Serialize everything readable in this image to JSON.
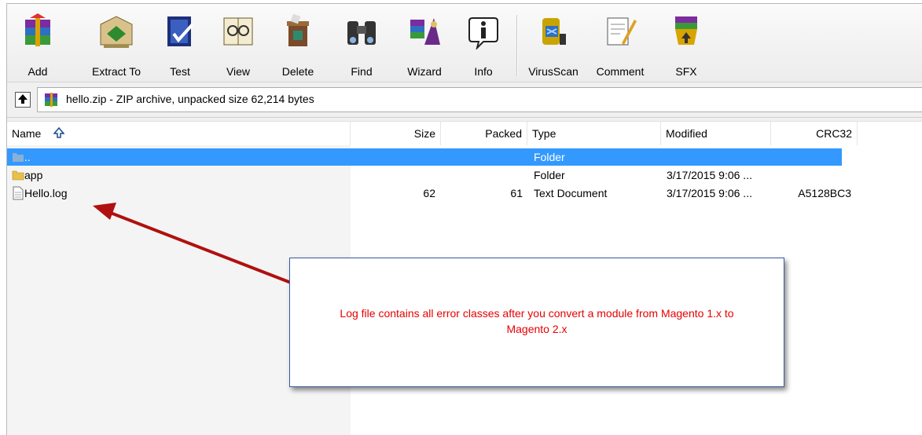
{
  "toolbar": {
    "buttons": [
      {
        "label": "Add",
        "icon": "add-archive-icon"
      },
      {
        "label": "Extract To",
        "icon": "extract-icon"
      },
      {
        "label": "Test",
        "icon": "test-icon"
      },
      {
        "label": "View",
        "icon": "view-icon"
      },
      {
        "label": "Delete",
        "icon": "delete-icon"
      },
      {
        "label": "Find",
        "icon": "find-icon"
      },
      {
        "label": "Wizard",
        "icon": "wizard-icon"
      },
      {
        "label": "Info",
        "icon": "info-icon"
      },
      {
        "label": "VirusScan",
        "icon": "virusscan-icon"
      },
      {
        "label": "Comment",
        "icon": "comment-icon"
      },
      {
        "label": "SFX",
        "icon": "sfx-icon"
      }
    ]
  },
  "address": {
    "text": "hello.zip - ZIP archive, unpacked size 62,214 bytes"
  },
  "columns": {
    "name": "Name",
    "size": "Size",
    "packed": "Packed",
    "type": "Type",
    "modified": "Modified",
    "crc": "CRC32"
  },
  "files": [
    {
      "name": "..",
      "size": "",
      "packed": "",
      "type": "Folder",
      "modified": "",
      "crc": "",
      "icon": "folder-icon"
    },
    {
      "name": "app",
      "size": "",
      "packed": "",
      "type": "Folder",
      "modified": "3/17/2015 9:06 ...",
      "crc": "",
      "icon": "folder-icon"
    },
    {
      "name": "Hello.log",
      "size": "62",
      "packed": "61",
      "type": "Text Document",
      "modified": "3/17/2015 9:06 ...",
      "crc": "A5128BC3",
      "icon": "text-file-icon"
    }
  ],
  "callout": {
    "line1": "Log file contains all error classes after you convert a module from Magento 1.x to",
    "line2": "Magento 2.x"
  },
  "colors": {
    "selection": "#3399ff",
    "callout_text": "#e60000",
    "arrow": "#b01010",
    "callout_border": "#3b5a9e"
  }
}
